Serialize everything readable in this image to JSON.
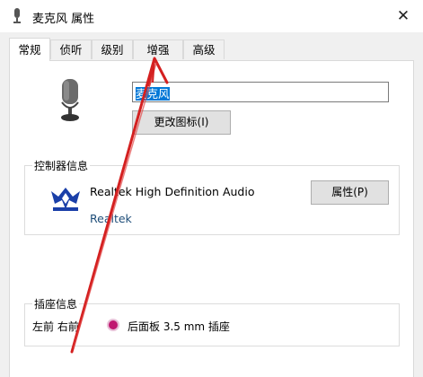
{
  "window": {
    "title": "麦克风 属性",
    "close_glyph": "✕"
  },
  "tabs": [
    {
      "label": "常规",
      "active": true
    },
    {
      "label": "侦听",
      "active": false
    },
    {
      "label": "级别",
      "active": false
    },
    {
      "label": "增强",
      "active": false
    },
    {
      "label": "高级",
      "active": false
    }
  ],
  "device": {
    "icon": "microphone-icon",
    "name_value": "麦克风",
    "change_icon_button": "更改图标(I)"
  },
  "controller": {
    "group_label": "控制器信息",
    "icon": "realtek-icon",
    "name": "Realtek High Definition Audio",
    "vendor": "Realtek",
    "properties_button": "属性(P)"
  },
  "jack": {
    "group_label": "插座信息",
    "location": "左前 右前",
    "jack_color": "#c01870",
    "description": "后面板 3.5 mm 插座"
  },
  "annotation": {
    "color": "#d42020",
    "description_icon": "red-arrow-annotation"
  }
}
